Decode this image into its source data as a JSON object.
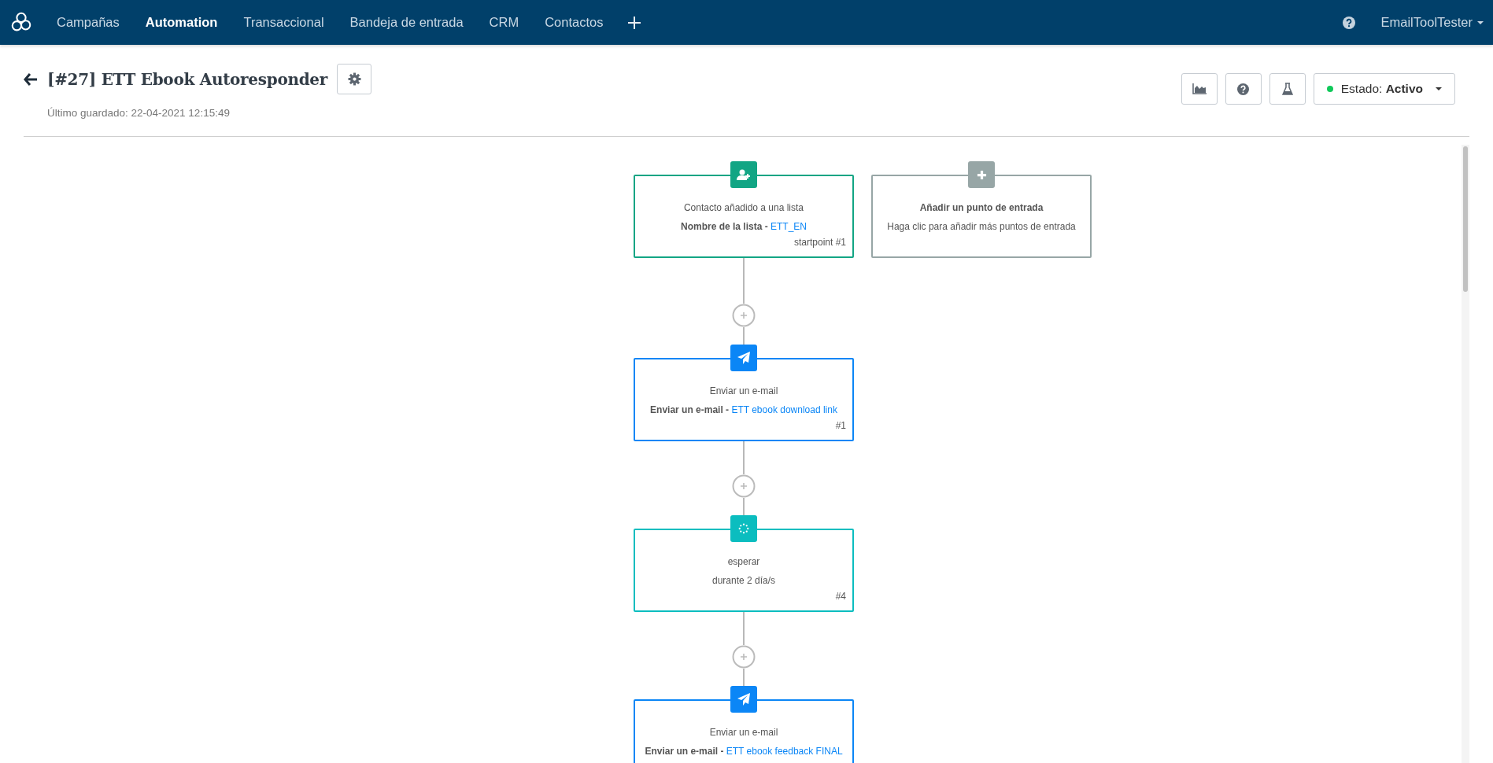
{
  "nav": {
    "items": [
      {
        "label": "Campañas",
        "selected": false
      },
      {
        "label": "Automation",
        "selected": true
      },
      {
        "label": "Transaccional",
        "selected": false
      },
      {
        "label": "Bandeja de entrada",
        "selected": false
      },
      {
        "label": "CRM",
        "selected": false
      },
      {
        "label": "Contactos",
        "selected": false
      }
    ],
    "user": "EmailToolTester"
  },
  "header": {
    "title": "[#27] ETT Ebook Autoresponder",
    "last_saved": "Último guardado: 22-04-2021 12:15:49",
    "status": {
      "label": "Estado:",
      "value": "Activo",
      "active": true
    }
  },
  "workflow": {
    "nodes": [
      {
        "kind": "trigger",
        "title": "Contacto añadido a una lista",
        "detail": "Nombre de la lista - ",
        "link": "ETT_EN",
        "footer": "startpoint #1"
      },
      {
        "kind": "email",
        "title": "Enviar un e-mail",
        "detail": "Enviar un e-mail - ",
        "link": "ETT ebook download link",
        "footer": "#1"
      },
      {
        "kind": "wait",
        "title": "esperar",
        "detail": "durante 2 día/s",
        "footer": "#4"
      },
      {
        "kind": "email",
        "title": "Enviar un e-mail",
        "detail": "Enviar un e-mail - ",
        "link": "ETT ebook feedback FINAL"
      }
    ],
    "entry_point": {
      "kind": "add",
      "title": "Añadir un punto de entrada",
      "detail": "Haga clic para añadir más puntos de entrada"
    }
  }
}
